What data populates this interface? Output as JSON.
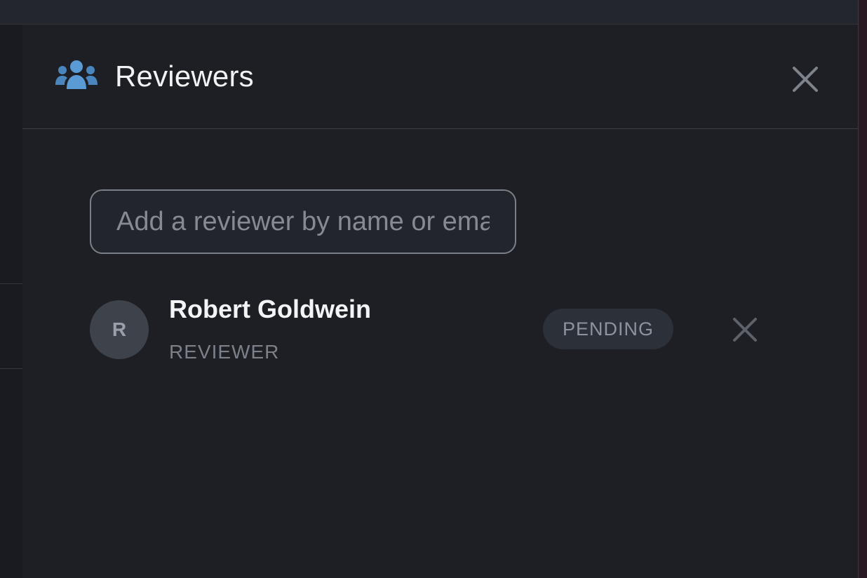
{
  "panel": {
    "title": "Reviewers",
    "header_icon": "users-icon",
    "close_icon": "close-icon"
  },
  "search": {
    "placeholder": "Add a reviewer by name or email",
    "value": ""
  },
  "reviewers": [
    {
      "avatar_initial": "R",
      "name": "Robert Goldwein",
      "role": "REVIEWER",
      "status": "PENDING",
      "remove_icon": "close-icon"
    }
  ],
  "colors": {
    "background": "#1d1f24",
    "accent_icon": "#5b9bd5",
    "text_primary": "#f1f2f4",
    "text_muted": "#7b808a",
    "badge_bg": "#2c3038"
  }
}
